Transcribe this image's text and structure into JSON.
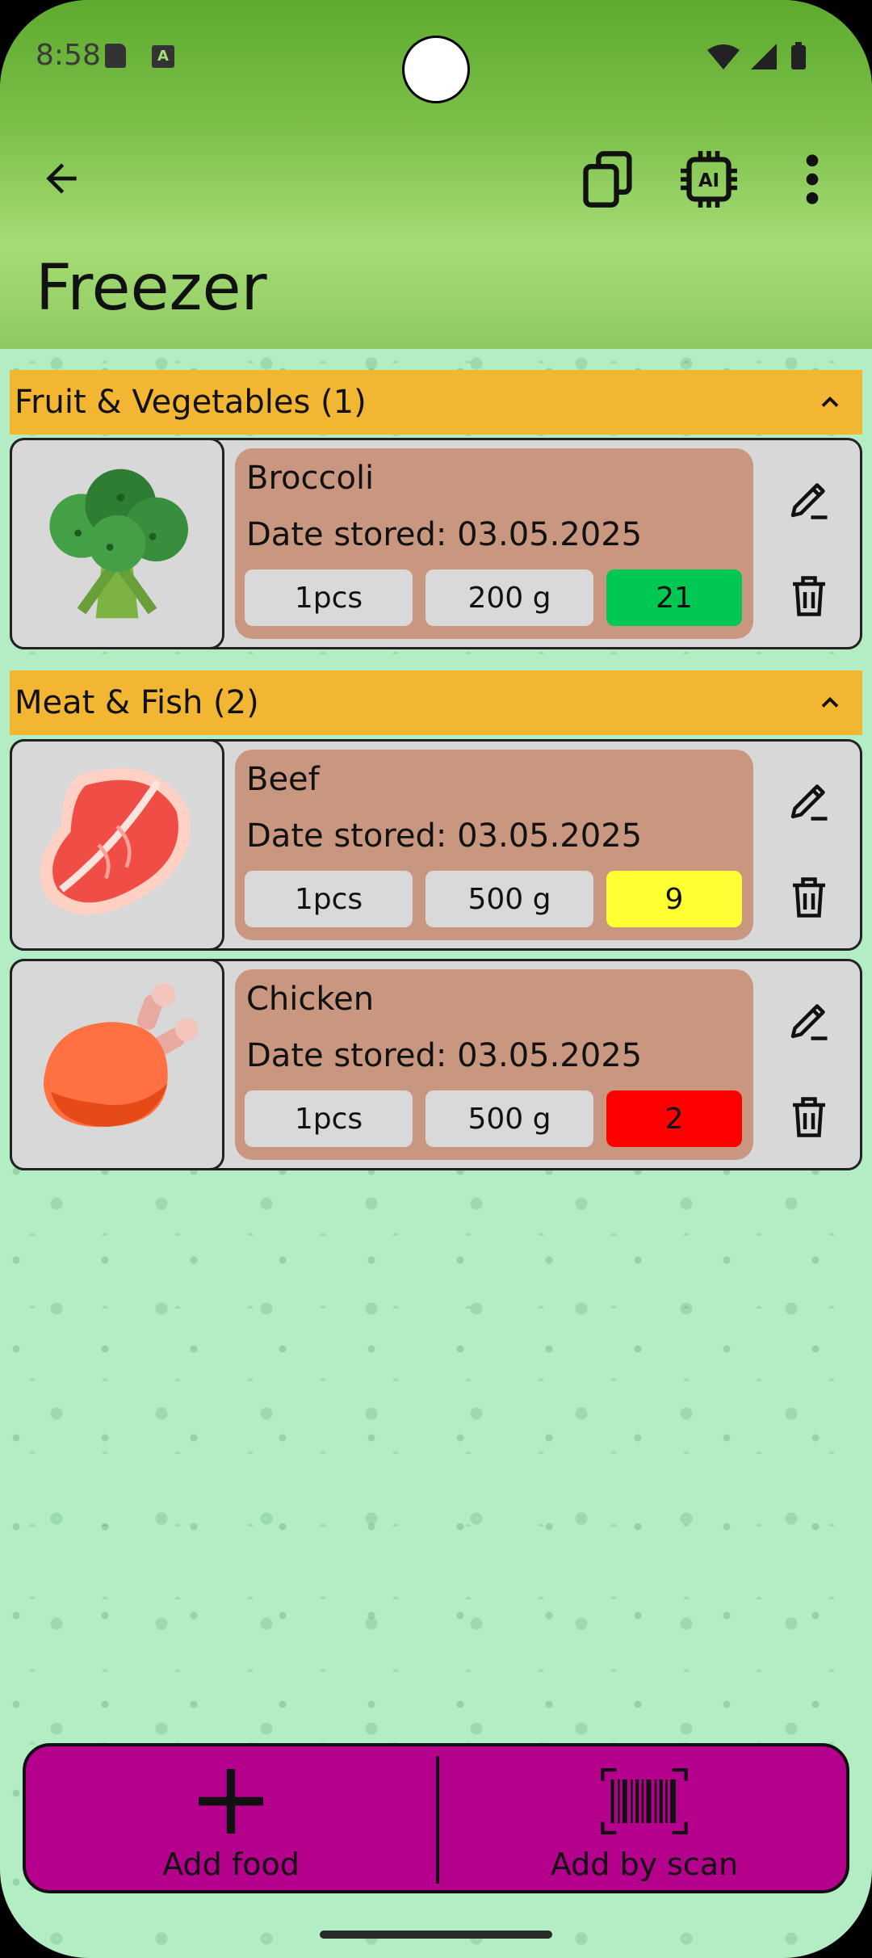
{
  "status": {
    "time": "8:58"
  },
  "app": {
    "title": "Freezer"
  },
  "categories": [
    {
      "header": "Fruit & Vegetables (1)",
      "items": [
        {
          "name": "Broccoli",
          "date": "Date stored: 03.05.2025",
          "qty": "1pcs",
          "weight": "200 g",
          "days": "21",
          "days_color": "#00c853",
          "icon": "broccoli-icon"
        }
      ]
    },
    {
      "header": "Meat & Fish (2)",
      "items": [
        {
          "name": "Beef",
          "date": "Date stored: 03.05.2025",
          "qty": "1pcs",
          "weight": "500 g",
          "days": "9",
          "days_color": "#ffff33",
          "icon": "steak-icon"
        },
        {
          "name": "Chicken",
          "date": "Date stored: 03.05.2025",
          "qty": "1pcs",
          "weight": "500 g",
          "days": "2",
          "days_color": "#ff0000",
          "icon": "chicken-leg-icon"
        }
      ]
    }
  ],
  "bottom": {
    "add_food": "Add food",
    "add_by_scan": "Add by scan"
  },
  "colors": {
    "header_bar": "#8ecb60",
    "category": "#f3b632",
    "info_box": "#c99780",
    "bottom_bar": "#b5008d",
    "background": "#b3edc4"
  }
}
